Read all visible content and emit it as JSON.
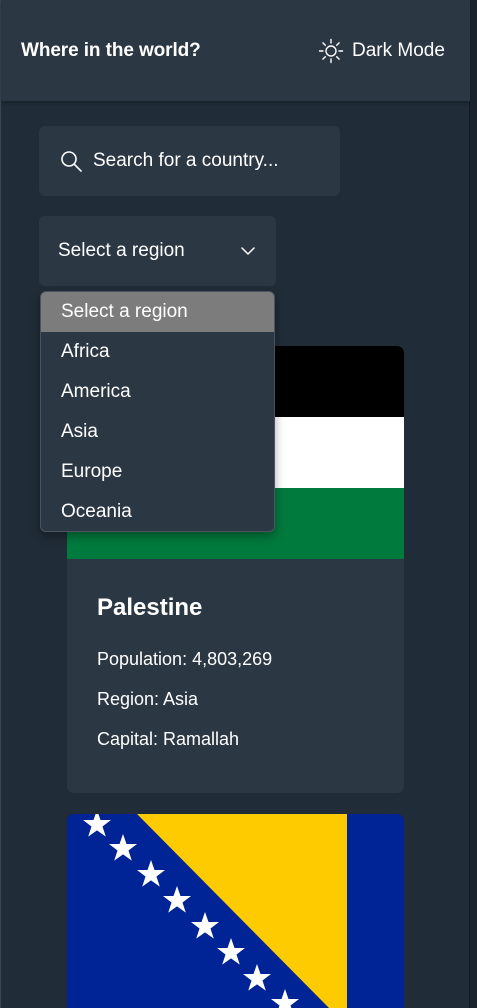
{
  "header": {
    "title": "Where in the world?",
    "theme_toggle_label": "Dark Mode",
    "theme_icon": "sun-icon"
  },
  "search": {
    "placeholder": "Search for a country...",
    "value": "",
    "icon": "search-icon"
  },
  "region_filter": {
    "selected_label": "Select a region",
    "icon": "chevron-down-icon",
    "options": [
      "Select a region",
      "Africa",
      "America",
      "Asia",
      "Europe",
      "Oceania"
    ],
    "highlighted_index": 0
  },
  "countries": [
    {
      "name": "Palestine",
      "population_label": "Population: 4,803,269",
      "region_label": "Region: Asia",
      "capital_label": "Capital: Ramallah",
      "flag": {
        "colors": [
          "#000000",
          "#ffffff",
          "#007a3d"
        ]
      }
    },
    {
      "name": "",
      "flag": {
        "colors": [
          "#002395",
          "#fecb00",
          "#ffffff"
        ]
      }
    }
  ],
  "theme": {
    "background": "#202c37",
    "element": "#2b3743",
    "text": "#ffffff",
    "option_highlight": "#7c7c7c"
  }
}
